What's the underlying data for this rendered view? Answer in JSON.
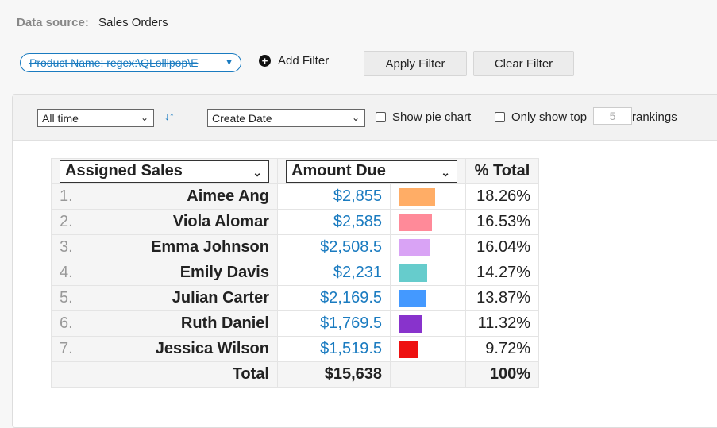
{
  "data_source": {
    "label": "Data source:",
    "value": "Sales Orders"
  },
  "filters": {
    "active_filter": "Product Name: regex:\\QLollipop\\E",
    "add_filter_label": "Add Filter",
    "apply_label": "Apply Filter",
    "clear_label": "Clear Filter"
  },
  "toolbar": {
    "time_range": "All time",
    "date_field": "Create Date",
    "show_pie_label": "Show pie chart",
    "only_top_label": "Only show top",
    "top_n_placeholder": "5",
    "rankings_label": "rankings"
  },
  "table": {
    "group_by": "Assigned Sales",
    "measure": "Amount Due",
    "pct_header": "% Total",
    "rows": [
      {
        "rank": "1.",
        "name": "Aimee Ang",
        "amount": "$2,855",
        "pct": "18.26%",
        "fraction": 0.1826,
        "color": "#ffad66"
      },
      {
        "rank": "2.",
        "name": "Viola Alomar",
        "amount": "$2,585",
        "pct": "16.53%",
        "fraction": 0.1653,
        "color": "#ff8a99"
      },
      {
        "rank": "3.",
        "name": "Emma Johnson",
        "amount": "$2,508.5",
        "pct": "16.04%",
        "fraction": 0.1604,
        "color": "#d9a3f5"
      },
      {
        "rank": "4.",
        "name": "Emily Davis",
        "amount": "$2,231",
        "pct": "14.27%",
        "fraction": 0.1427,
        "color": "#66cccc"
      },
      {
        "rank": "5.",
        "name": "Julian Carter",
        "amount": "$2,169.5",
        "pct": "13.87%",
        "fraction": 0.1387,
        "color": "#4499ff"
      },
      {
        "rank": "6.",
        "name": "Ruth Daniel",
        "amount": "$1,769.5",
        "pct": "11.32%",
        "fraction": 0.1132,
        "color": "#8833cc"
      },
      {
        "rank": "7.",
        "name": "Jessica Wilson",
        "amount": "$1,519.5",
        "pct": "9.72%",
        "fraction": 0.0972,
        "color": "#ee1111"
      }
    ],
    "total": {
      "label": "Total",
      "amount": "$15,638",
      "pct": "100%"
    }
  }
}
